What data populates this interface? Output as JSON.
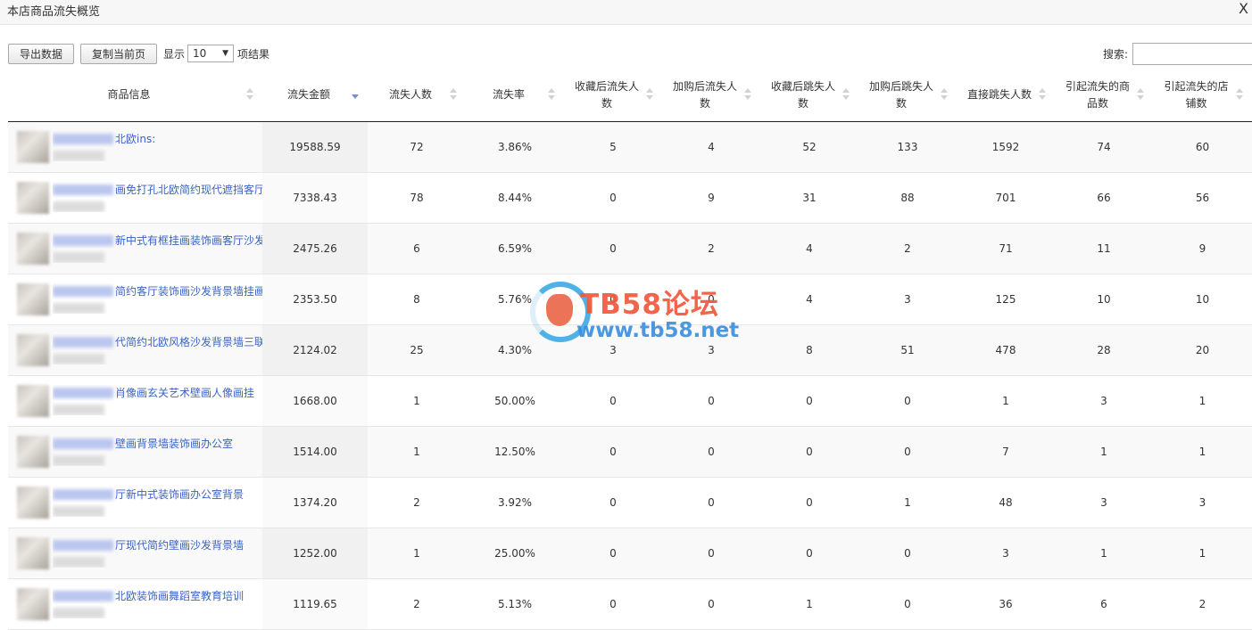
{
  "window": {
    "title": "本店商品流失概览",
    "close_glyph": "X"
  },
  "toolbar": {
    "export_label": "导出数据",
    "copy_label": "复制当前页",
    "show_label": "显示",
    "page_size": "10",
    "suffix_label": "项结果",
    "search_label": "搜索:",
    "search_value": ""
  },
  "table": {
    "headers": [
      "商品信息",
      "流失金额",
      "流失人数",
      "流失率",
      "收藏后流失人数",
      "加购后流失人数",
      "收藏后跳失人数",
      "加购后跳失人数",
      "直接跳失人数",
      "引起流失的商品数",
      "引起流失的店铺数"
    ],
    "rows": [
      {
        "name": "北欧ins:",
        "amount": "19588.59",
        "lost": "72",
        "rate": "3.86%",
        "fav_lost": "5",
        "cart_lost": "4",
        "fav_bounce": "52",
        "cart_bounce": "133",
        "direct_bounce": "1592",
        "items": "74",
        "shops": "60"
      },
      {
        "name": "画免打孔北欧简约现代遮挡客厅点",
        "amount": "7338.43",
        "lost": "78",
        "rate": "8.44%",
        "fav_lost": "0",
        "cart_lost": "9",
        "fav_bounce": "31",
        "cart_bounce": "88",
        "direct_bounce": "701",
        "items": "66",
        "shops": "56"
      },
      {
        "name": "新中式有框挂画装饰画客厅沙发背",
        "amount": "2475.26",
        "lost": "6",
        "rate": "6.59%",
        "fav_lost": "0",
        "cart_lost": "2",
        "fav_bounce": "4",
        "cart_bounce": "2",
        "direct_bounce": "71",
        "items": "11",
        "shops": "9"
      },
      {
        "name": "简约客厅装饰画沙发背景墙挂画",
        "amount": "2353.50",
        "lost": "8",
        "rate": "5.76%",
        "fav_lost": "0",
        "cart_lost": "0",
        "fav_bounce": "4",
        "cart_bounce": "3",
        "direct_bounce": "125",
        "items": "10",
        "shops": "10"
      },
      {
        "name": "代简约北欧风格沙发背景墙三联",
        "amount": "2124.02",
        "lost": "25",
        "rate": "4.30%",
        "fav_lost": "3",
        "cart_lost": "3",
        "fav_bounce": "8",
        "cart_bounce": "51",
        "direct_bounce": "478",
        "items": "28",
        "shops": "20"
      },
      {
        "name": "肖像画玄关艺术壁画人像画挂",
        "amount": "1668.00",
        "lost": "1",
        "rate": "50.00%",
        "fav_lost": "0",
        "cart_lost": "0",
        "fav_bounce": "0",
        "cart_bounce": "0",
        "direct_bounce": "1",
        "items": "3",
        "shops": "1"
      },
      {
        "name": "壁画背景墙装饰画办公室",
        "amount": "1514.00",
        "lost": "1",
        "rate": "12.50%",
        "fav_lost": "0",
        "cart_lost": "0",
        "fav_bounce": "0",
        "cart_bounce": "0",
        "direct_bounce": "7",
        "items": "1",
        "shops": "1"
      },
      {
        "name": "厅新中式装饰画办公室背景",
        "amount": "1374.20",
        "lost": "2",
        "rate": "3.92%",
        "fav_lost": "0",
        "cart_lost": "0",
        "fav_bounce": "0",
        "cart_bounce": "1",
        "direct_bounce": "48",
        "items": "3",
        "shops": "3"
      },
      {
        "name": "厅现代简约壁画沙发背景墙",
        "amount": "1252.00",
        "lost": "1",
        "rate": "25.00%",
        "fav_lost": "0",
        "cart_lost": "0",
        "fav_bounce": "0",
        "cart_bounce": "0",
        "direct_bounce": "3",
        "items": "1",
        "shops": "1"
      },
      {
        "name": "北欧装饰画舞蹈室教育培训",
        "amount": "1119.65",
        "lost": "2",
        "rate": "5.13%",
        "fav_lost": "0",
        "cart_lost": "0",
        "fav_bounce": "1",
        "cart_bounce": "0",
        "direct_bounce": "36",
        "items": "6",
        "shops": "2"
      }
    ]
  },
  "watermark": {
    "title": "TB58论坛",
    "url": "www.tb58.net"
  },
  "colors": {
    "link": "#3b63c4",
    "sort_active": "#7a8cc9",
    "watermark_red": "#f0593b",
    "watermark_blue": "#3d8fde"
  },
  "icons": [
    "close-icon",
    "dropdown-arrow-icon",
    "sort-icon",
    "sort-desc-icon",
    "watermark-logo-icon"
  ]
}
